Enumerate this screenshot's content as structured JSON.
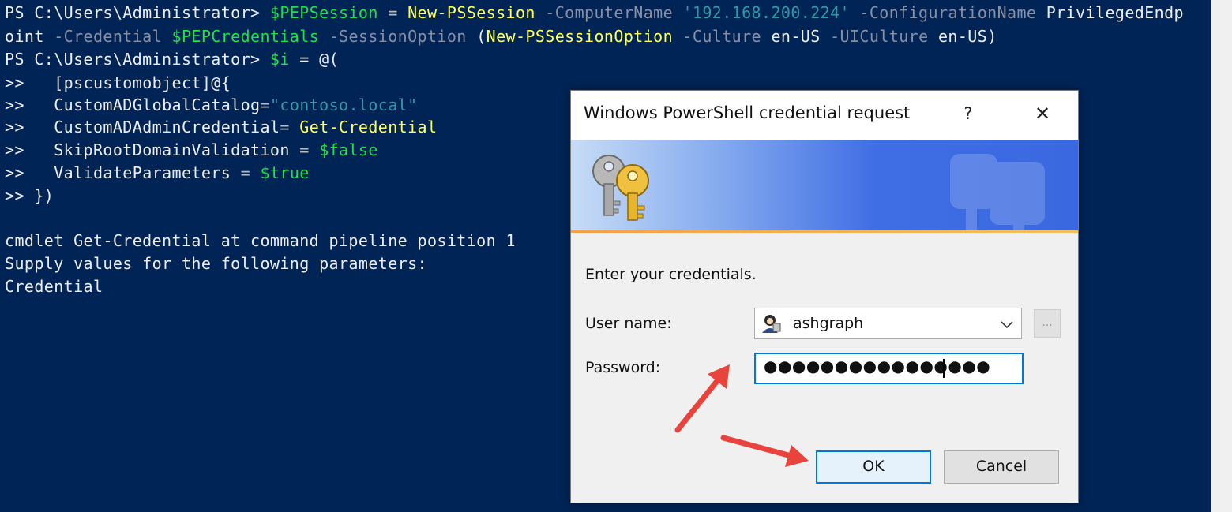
{
  "console": {
    "line1": {
      "prompt": "PS C:\\Users\\Administrator> ",
      "var": "$PEPSession",
      "eq": " = ",
      "cmd": "New-PSSession",
      "p1": " -ComputerName ",
      "ip": "'192.168.200.224'",
      "p2": " -ConfigurationName ",
      "rest": "PrivilegedEndp"
    },
    "line2": {
      "a": "oint",
      "p1": " -Credential ",
      "var": "$PEPCredentials",
      "p2": " -SessionOption ",
      "paren": "(",
      "cmd": "New-PSSessionOption",
      "p3": " -Culture ",
      "v1": "en-US",
      "p4": " -UICulture ",
      "v2": "en-US",
      "close": ")"
    },
    "line3": {
      "prompt": "PS C:\\Users\\Administrator> ",
      "var": "$i",
      "rest": " = @("
    },
    "line4": {
      "prefix": ">>   ",
      "text": "[pscustomobject]@{"
    },
    "line5": {
      "prefix": ">>   ",
      "key": "CustomADGlobalCatalog",
      "eq": "=",
      "val": "\"contoso.local\""
    },
    "line6": {
      "prefix": ">>   ",
      "key": "CustomADAdminCredential",
      "eq": "= ",
      "val": "Get-Credential"
    },
    "line7": {
      "prefix": ">>   ",
      "key": "SkipRootDomainValidation",
      "eq": " = ",
      "val": "$false"
    },
    "line8": {
      "prefix": ">>   ",
      "key": "ValidateParameters",
      "eq": " = ",
      "val": "$true"
    },
    "line9": {
      "text": ">> })"
    },
    "line10": {
      "text": "cmdlet Get-Credential at command pipeline position 1"
    },
    "line11": {
      "text": "Supply values for the following parameters:"
    },
    "line12": {
      "text": "Credential"
    }
  },
  "dialog": {
    "title": "Windows PowerShell credential request",
    "help_label": "?",
    "close_label": "✕",
    "prompt": "Enter your credentials.",
    "username_label": "User name:",
    "username_value": "ashgraph",
    "browse_label": "...",
    "password_label": "Password:",
    "password_value": "●●●●●●●●●●●●●●●●",
    "ok_label": "OK",
    "cancel_label": "Cancel"
  },
  "colors": {
    "console_bg": "#012456",
    "variable": "#1fe044",
    "command": "#ffff54",
    "parameter": "#8a8fa3",
    "string": "#2f9aa6",
    "arrow": "#e8433d",
    "focus": "#0078d7"
  }
}
